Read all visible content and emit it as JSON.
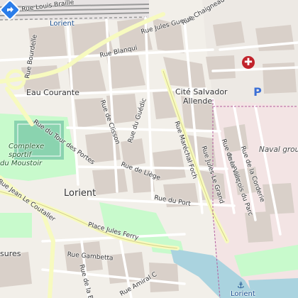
{
  "map": {
    "places": {
      "city_top": "Lorient",
      "city_center": "Lorient",
      "eau_courante": "Eau Courante",
      "cite_salvador_line1": "Cité Salvador",
      "cite_salvador_line2": "Allende",
      "complexe_line1": "Complexe",
      "complexe_line2": "sportif",
      "complexe_line3": "du Moustoir",
      "naval": "Naval grou",
      "lorient_bottom": "Lorient"
    },
    "streets": {
      "rue_louis_braille": "Rue Louis Braille",
      "rue_jules_guesde": "Rue Jules Guesde",
      "rue_chaigneau": "Rue Chaigneau",
      "rue_blanqui": "Rue Blanqui",
      "rue_bourdelle": "Rue Bourdelle",
      "rue_de_clisson": "Rue de Clisson",
      "rue_de_guedic": "Rue du Guédic",
      "rue_du_tour_des_portes": "Rue du Tour des Portes",
      "rue_marechal_foch": "Rue Maréchal Foch",
      "rue_jules_le_grand": "Rue Jules Le Grand",
      "rue_de_liege": "Rue de Liège",
      "rue_du_port": "Rue du Port",
      "rue_jean_le_coutaller": "Rue Jean Le Coutaller",
      "place_jules_ferry": "Place Jules Ferry",
      "rue_gambetta": "Rue Gambetta",
      "rue_de_la_belle": "Rue de la Belle",
      "rue_amiral": "Rue Amiral C",
      "rue_de_la_corderie": "Rue de la Corderie",
      "rue_francois_du_parc": "Rue François du Parc",
      "rue_de_la_ville": "Rue de la Ville",
      "sures": "sures"
    },
    "icons": {
      "pin": "direction-pin-icon",
      "hospital": "hospital-icon",
      "parking": "parking-icon",
      "anchor": "anchor-icon"
    },
    "symbols": {
      "hospital_glyph": "✚",
      "parking_glyph": "P",
      "anchor_glyph": "⚓"
    },
    "colors": {
      "background": "#f2efe9",
      "block": "#d9d0c9",
      "road": "#ffffff",
      "major_road": "#f7fabf",
      "park": "#c8facc",
      "sport": "#8ad3af",
      "water": "#aad3df",
      "military": "#f3e4e4",
      "rail": "#999999",
      "pin": "#2b7de9"
    }
  }
}
